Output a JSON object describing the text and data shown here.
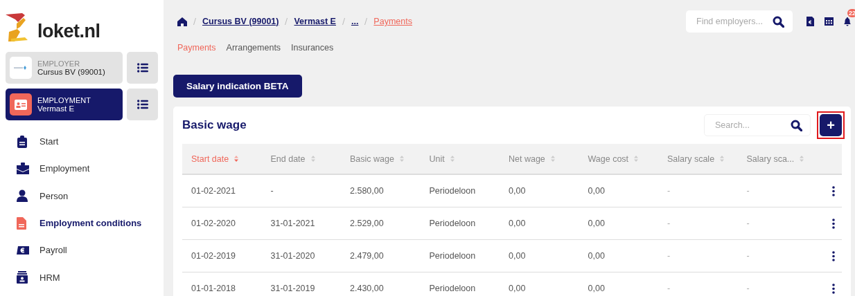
{
  "logo": {
    "text": "loket.nl"
  },
  "context_cards": [
    {
      "caption": "EMPLOYER",
      "name": "Cursus BV (99001)",
      "selected": false,
      "kind": "employer"
    },
    {
      "caption": "EMPLOYMENT",
      "name": "Vermast E",
      "selected": true,
      "kind": "employment"
    }
  ],
  "sidebar": {
    "items": [
      {
        "label": "Start",
        "selected": false,
        "kind": "clipboard"
      },
      {
        "label": "Employment",
        "selected": false,
        "kind": "briefcase"
      },
      {
        "label": "Person",
        "selected": false,
        "kind": "person"
      },
      {
        "label": "Employment conditions",
        "selected": true,
        "kind": "document"
      },
      {
        "label": "Payroll",
        "selected": false,
        "kind": "euro"
      },
      {
        "label": "HRM",
        "selected": false,
        "kind": "badge"
      }
    ]
  },
  "breadcrumb": [
    {
      "label": "Cursus BV (99001)",
      "selected": false
    },
    {
      "label": "Vermast E",
      "selected": false
    },
    {
      "label": "...",
      "selected": false
    },
    {
      "label": "Payments",
      "selected": true
    }
  ],
  "search": {
    "placeholder": "Find employers..."
  },
  "notifications": {
    "count": "22"
  },
  "tabs": [
    {
      "label": "Payments",
      "selected": true
    },
    {
      "label": "Arrangements",
      "selected": false
    },
    {
      "label": "Insurances",
      "selected": false
    }
  ],
  "salary_button": {
    "label": "Salary indication BETA"
  },
  "card": {
    "title": "Basic wage",
    "search_placeholder": "Search...",
    "add_button": {
      "label": "+",
      "highlighted": true
    }
  },
  "table": {
    "columns": [
      {
        "label": "Start date",
        "sorted": true
      },
      {
        "label": "End date",
        "sorted": false
      },
      {
        "label": "Basic wage",
        "sorted": false
      },
      {
        "label": "Unit",
        "sorted": false
      },
      {
        "label": "Net wage",
        "sorted": false
      },
      {
        "label": "Wage cost",
        "sorted": false
      },
      {
        "label": "Salary scale",
        "sorted": false
      },
      {
        "label": "Salary sca...",
        "sorted": false
      }
    ],
    "rows": [
      [
        "01-02-2021",
        "-",
        "2.580,00",
        "Periodeloon",
        "0,00",
        "0,00",
        "-",
        "-"
      ],
      [
        "01-02-2020",
        "31-01-2021",
        "2.529,00",
        "Periodeloon",
        "0,00",
        "0,00",
        "-",
        "-"
      ],
      [
        "01-02-2019",
        "31-01-2020",
        "2.479,00",
        "Periodeloon",
        "0,00",
        "0,00",
        "-",
        "-"
      ],
      [
        "01-01-2018",
        "31-01-2019",
        "2.430,00",
        "Periodeloon",
        "0,00",
        "0,00",
        "-",
        "-"
      ]
    ]
  }
}
